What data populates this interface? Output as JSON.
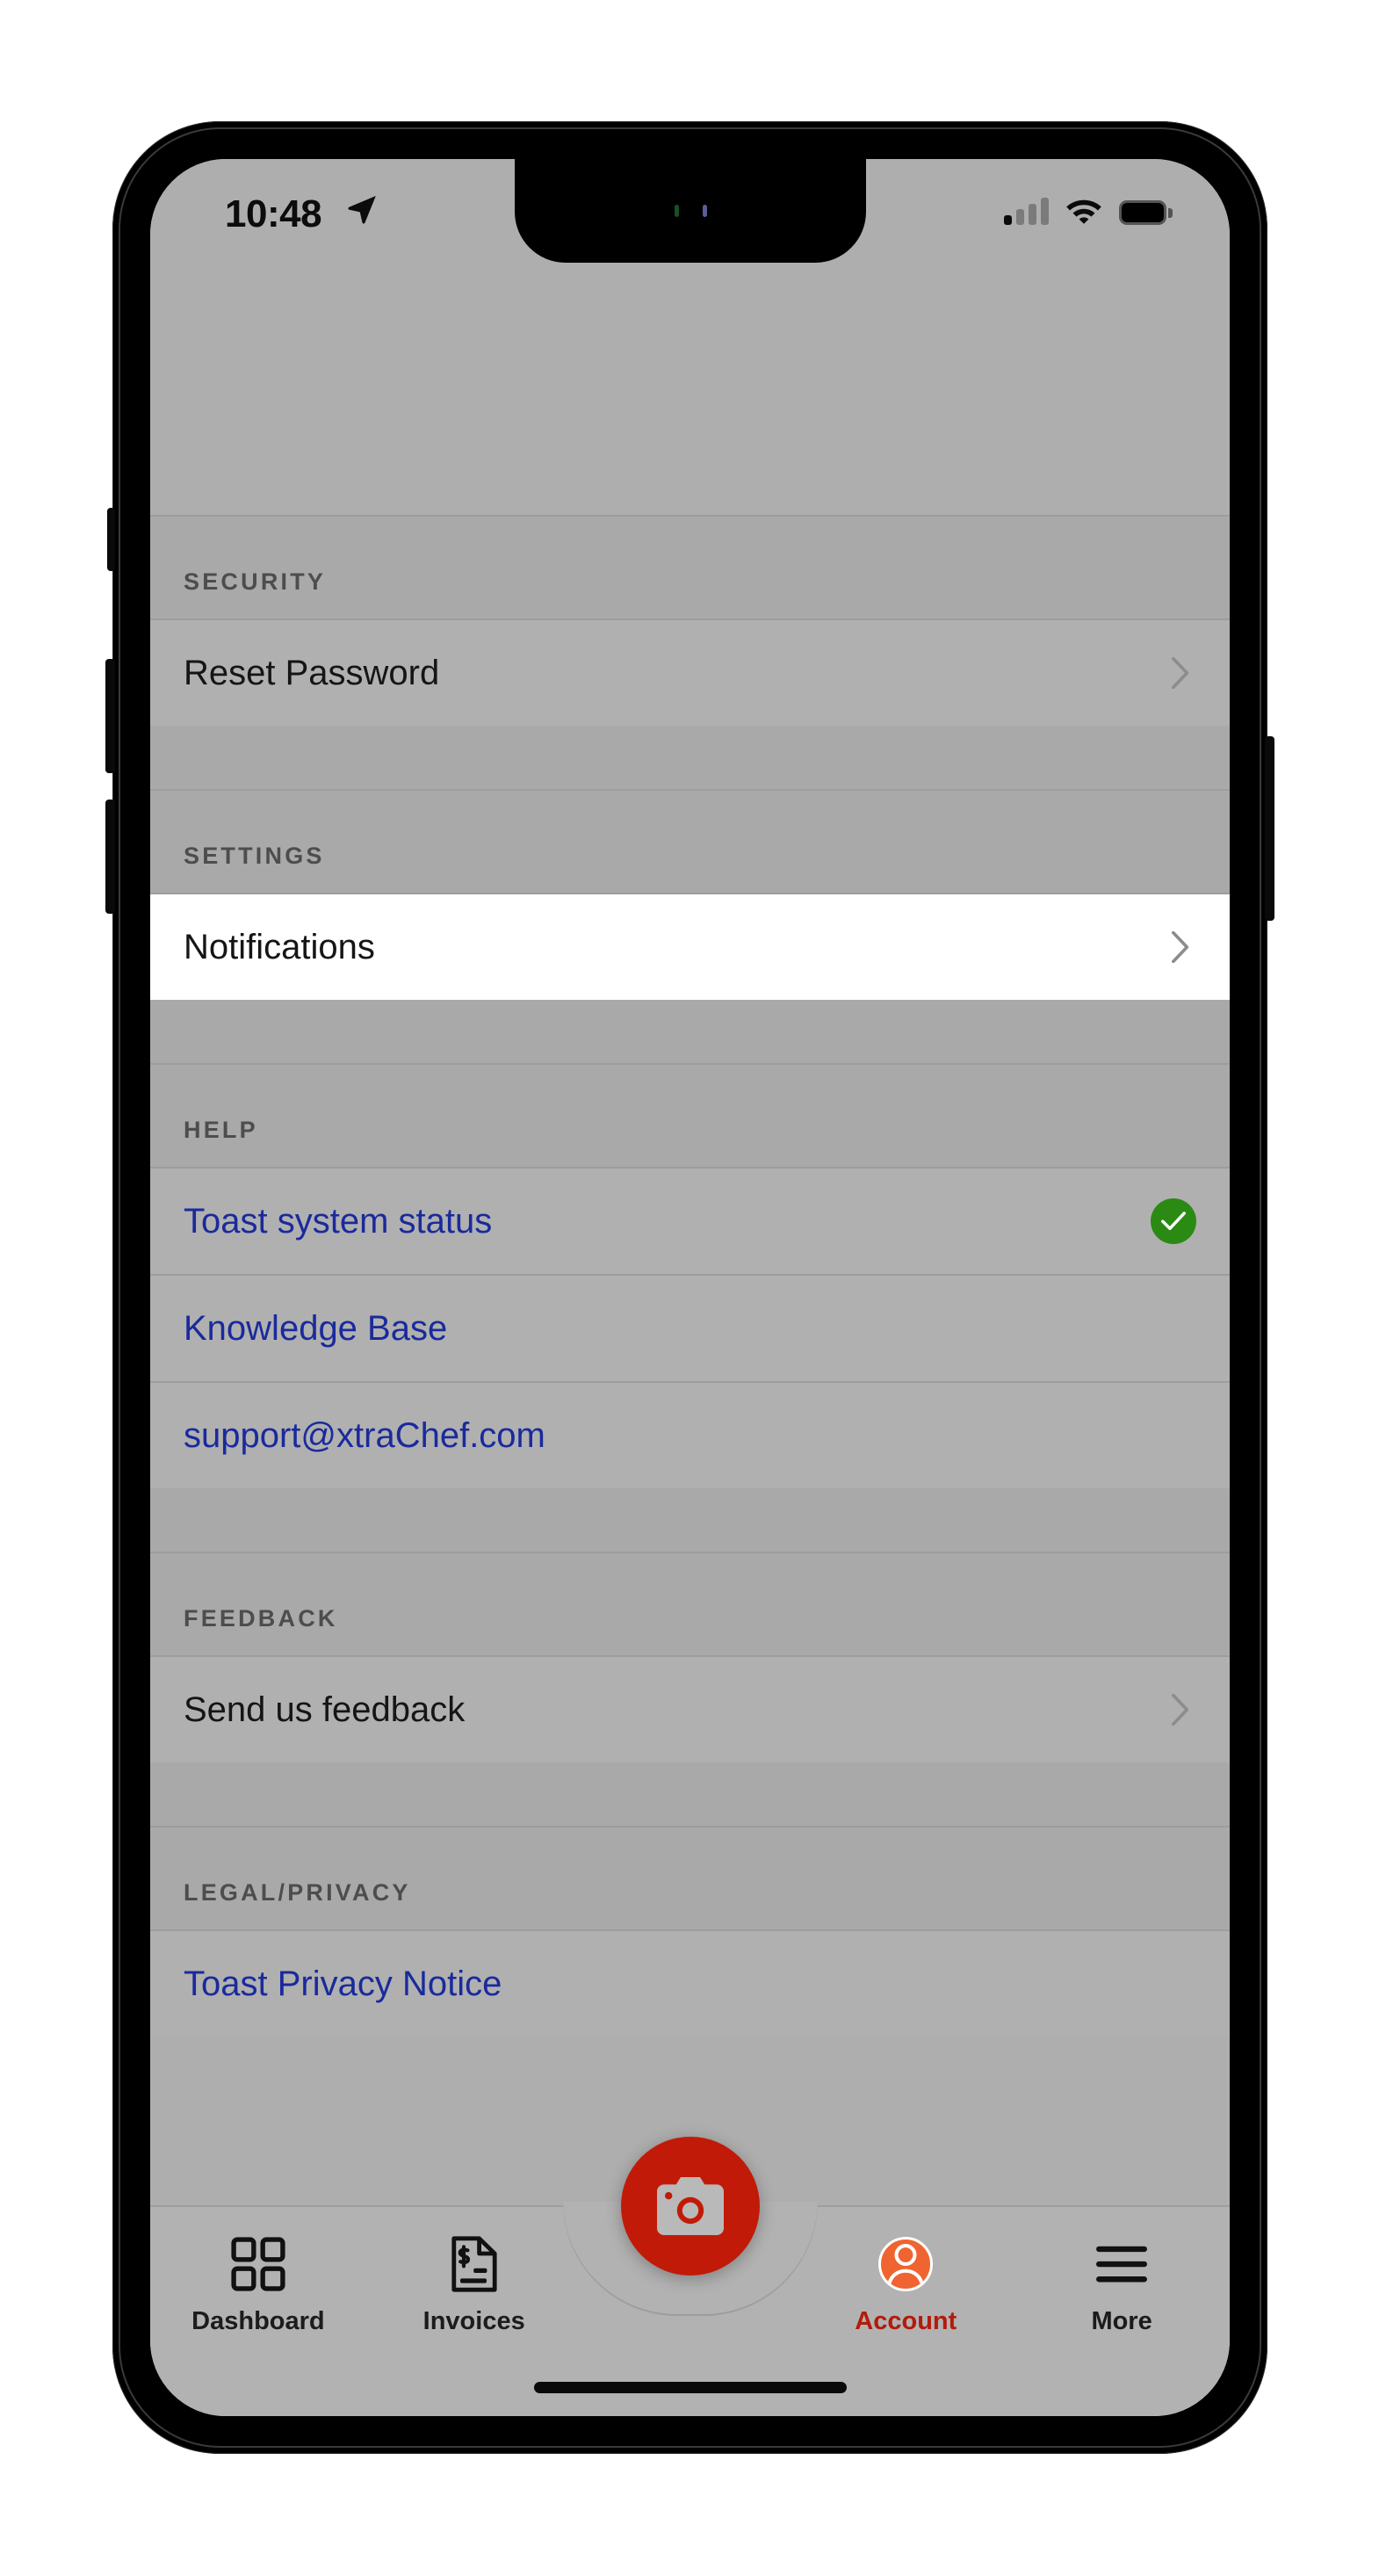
{
  "status_bar": {
    "time": "10:48",
    "location_icon": "location-arrow-icon",
    "signal_icon": "cellular-signal-icon",
    "wifi_icon": "wifi-icon",
    "battery_icon": "battery-full-icon"
  },
  "screen": {
    "background_color": "#aeaeae",
    "dimmed": true
  },
  "sections": [
    {
      "header": "SECURITY",
      "rows": [
        {
          "label": "Reset Password",
          "style": "default",
          "accessory": "chevron"
        }
      ]
    },
    {
      "header": "SETTINGS",
      "rows": [
        {
          "label": "Notifications",
          "style": "default",
          "accessory": "chevron",
          "highlighted": true
        }
      ]
    },
    {
      "header": "HELP",
      "rows": [
        {
          "label": "Toast system status",
          "style": "link",
          "accessory": "status-ok"
        },
        {
          "label": "Knowledge Base",
          "style": "link",
          "accessory": "none"
        },
        {
          "label": "support@xtraChef.com",
          "style": "link",
          "accessory": "none"
        }
      ]
    },
    {
      "header": "FEEDBACK",
      "rows": [
        {
          "label": "Send us feedback",
          "style": "default",
          "accessory": "chevron"
        }
      ]
    },
    {
      "header": "LEGAL/PRIVACY",
      "rows": [
        {
          "label": "Toast Privacy Notice",
          "style": "link",
          "accessory": "none"
        }
      ]
    }
  ],
  "tab_bar": {
    "items": [
      {
        "label": "Dashboard",
        "icon": "grid-icon",
        "active": false
      },
      {
        "label": "Invoices",
        "icon": "invoice-document-icon",
        "active": false
      },
      {
        "label": "Account",
        "icon": "account-avatar-icon",
        "active": true
      },
      {
        "label": "More",
        "icon": "hamburger-menu-icon",
        "active": false
      }
    ],
    "capture_button": {
      "icon": "camera-icon",
      "color": "#c21a08"
    },
    "active_color": "#b31b0c",
    "inactive_color": "#1c1c1c"
  },
  "colors": {
    "link": "#1a2a9c",
    "status_ok": "#2a8a13",
    "avatar": "#ef6430",
    "row_background": "#b0b0b0",
    "header_background": "#a9a9a9",
    "highlight_background": "#ffffff"
  }
}
